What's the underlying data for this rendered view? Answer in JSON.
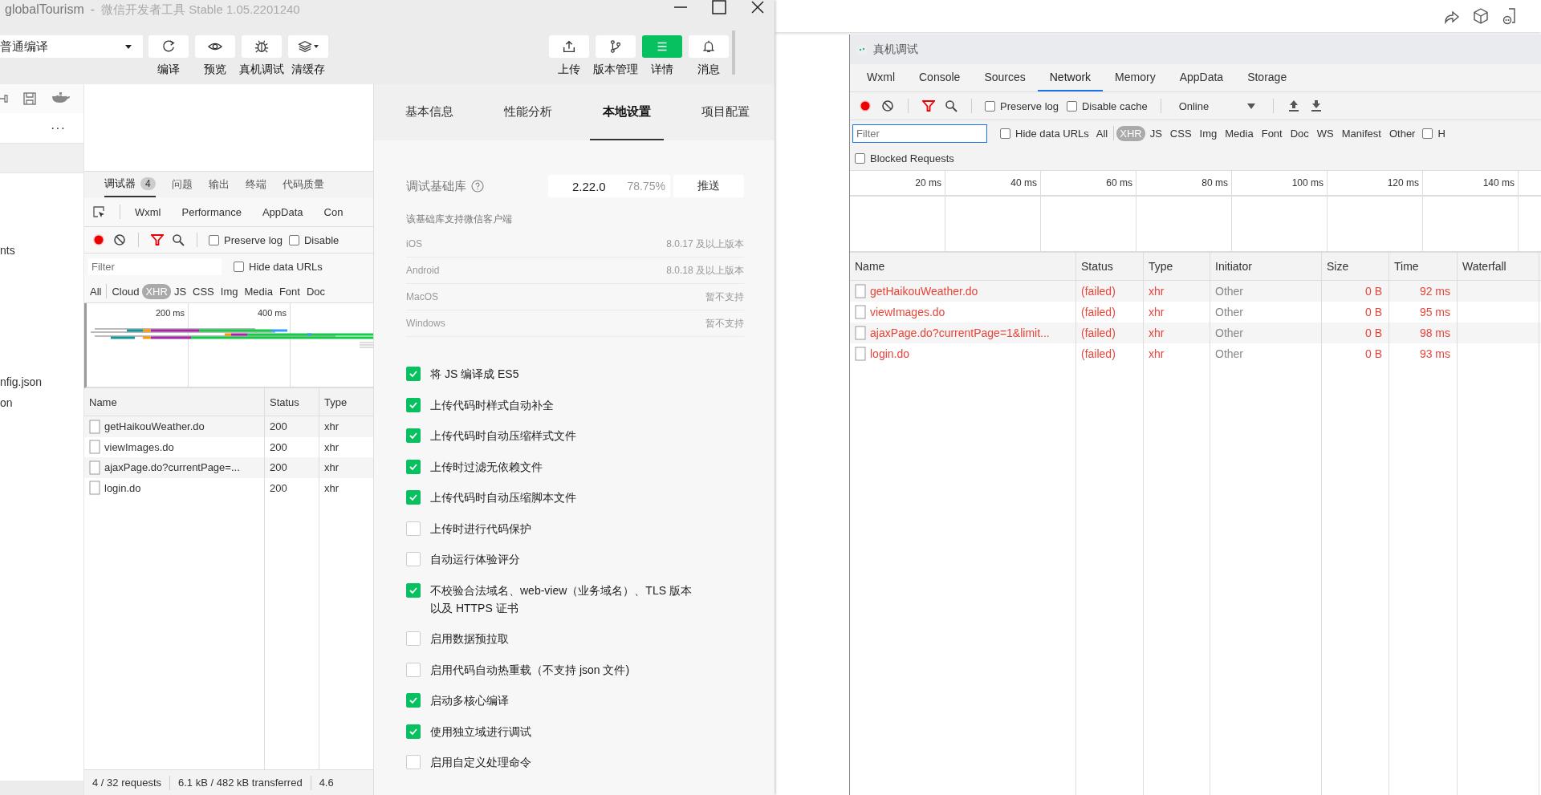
{
  "ide_window": {
    "project": "globalTourism",
    "separator": "-",
    "app": "微信开发者工具 Stable 1.05.2201240",
    "compile_mode": "普通编译",
    "toolbar_left": [
      {
        "label": "编译",
        "kind": "compile"
      },
      {
        "label": "预览",
        "kind": "preview"
      },
      {
        "label": "真机调试",
        "kind": "debug"
      },
      {
        "label": "清缓存",
        "kind": "cache"
      }
    ],
    "toolbar_right": [
      {
        "label": "上传",
        "kind": "upload",
        "selected": false
      },
      {
        "label": "版本管理",
        "kind": "branch",
        "selected": false
      },
      {
        "label": "详情",
        "kind": "details",
        "selected": true
      },
      {
        "label": "消息",
        "kind": "bell",
        "selected": false
      }
    ],
    "sidebar": {
      "more": "···",
      "items": [
        "nts",
        "nfig.json",
        "on"
      ]
    },
    "debugger": {
      "tabs": [
        {
          "label": "调试器",
          "badge": "4",
          "selected": true
        },
        {
          "label": "问题",
          "selected": false
        },
        {
          "label": "输出",
          "selected": false
        },
        {
          "label": "终端",
          "selected": false
        },
        {
          "label": "代码质量",
          "selected": false
        }
      ],
      "panels": [
        {
          "label": "Wxml",
          "selected": false
        },
        {
          "label": "Performance",
          "selected": false
        },
        {
          "label": "AppData",
          "selected": false
        },
        {
          "label": "Con",
          "selected": false
        }
      ],
      "preserve_log": {
        "label": "Preserve log",
        "checked": false
      },
      "disable_cache": {
        "label": "Disable",
        "checked": false
      },
      "filter": {
        "placeholder": "Filter"
      },
      "hide_data_urls": {
        "label": "Hide data URLs",
        "checked": false
      },
      "types": [
        {
          "label": "All",
          "selected": false
        },
        {
          "label": "Cloud",
          "selected": false
        },
        {
          "label": "XHR",
          "selected": true
        },
        {
          "label": "JS",
          "selected": false
        },
        {
          "label": "CSS",
          "selected": false
        },
        {
          "label": "Img",
          "selected": false
        },
        {
          "label": "Media",
          "selected": false
        },
        {
          "label": "Font",
          "selected": false
        },
        {
          "label": "Doc",
          "selected": false
        }
      ],
      "ticks": [
        "200 ms",
        "400 ms"
      ],
      "table": {
        "columns": [
          "Name",
          "Status",
          "Type"
        ],
        "rows": [
          {
            "name": "getHaikouWeather.do",
            "status": "200",
            "type": "xhr"
          },
          {
            "name": "viewImages.do",
            "status": "200",
            "type": "xhr"
          },
          {
            "name": "ajaxPage.do?currentPage=...",
            "status": "200",
            "type": "xhr"
          },
          {
            "name": "login.do",
            "status": "200",
            "type": "xhr"
          }
        ]
      },
      "status_bar": [
        "4 / 32 requests",
        "6.1 kB / 482 kB transferred",
        "4.6"
      ]
    },
    "details": {
      "tabs": [
        {
          "label": "基本信息",
          "selected": false
        },
        {
          "label": "性能分析",
          "selected": false
        },
        {
          "label": "本地设置",
          "selected": true
        },
        {
          "label": "项目配置",
          "selected": false
        }
      ],
      "library": {
        "label": "调试基础库",
        "version": "2.22.0",
        "share": "78.75%",
        "button": "推送"
      },
      "support_title": "该基础库支持微信客户端",
      "support": [
        {
          "platform": "iOS",
          "value": "8.0.17 及以上版本"
        },
        {
          "platform": "Android",
          "value": "8.0.18 及以上版本"
        },
        {
          "platform": "MacOS",
          "value": "暂不支持"
        },
        {
          "platform": "Windows",
          "value": "暂不支持"
        }
      ],
      "options": [
        {
          "label": "将 JS 编译成 ES5",
          "checked": true
        },
        {
          "label": "上传代码时样式自动补全",
          "checked": true
        },
        {
          "label": "上传代码时自动压缩样式文件",
          "checked": true
        },
        {
          "label": "上传时过滤无依赖文件",
          "checked": true
        },
        {
          "label": "上传代码时自动压缩脚本文件",
          "checked": true
        },
        {
          "label": "上传时进行代码保护",
          "checked": false
        },
        {
          "label": "自动运行体验评分",
          "checked": false
        },
        {
          "label": "不校验合法域名、web-view（业务域名）、TLS 版本以及 HTTPS 证书",
          "checked": true
        },
        {
          "label": "启用数据预拉取",
          "checked": false
        },
        {
          "label": "启用代码自动热重载（不支持 json 文件)",
          "checked": false
        },
        {
          "label": "启动多核心编译",
          "checked": true
        },
        {
          "label": "使用独立域进行调试",
          "checked": true
        },
        {
          "label": "启用自定义处理命令",
          "checked": false
        }
      ]
    }
  },
  "remote_window": {
    "title": "真机调试",
    "tabs": [
      {
        "label": "Wxml",
        "selected": false
      },
      {
        "label": "Console",
        "selected": false
      },
      {
        "label": "Sources",
        "selected": false
      },
      {
        "label": "Network",
        "selected": true
      },
      {
        "label": "Memory",
        "selected": false
      },
      {
        "label": "AppData",
        "selected": false
      },
      {
        "label": "Storage",
        "selected": false
      }
    ],
    "preserve_log": {
      "label": "Preserve log",
      "checked": false
    },
    "disable_cache": {
      "label": "Disable cache",
      "checked": false
    },
    "throttling": "Online",
    "filter": {
      "placeholder": "Filter"
    },
    "hide_data_urls": {
      "label": "Hide data URLs",
      "checked": false
    },
    "types": [
      {
        "label": "All",
        "selected": false
      },
      {
        "label": "XHR",
        "selected": true
      },
      {
        "label": "JS",
        "selected": false
      },
      {
        "label": "CSS",
        "selected": false
      },
      {
        "label": "Img",
        "selected": false
      },
      {
        "label": "Media",
        "selected": false
      },
      {
        "label": "Font",
        "selected": false
      },
      {
        "label": "Doc",
        "selected": false
      },
      {
        "label": "WS",
        "selected": false
      },
      {
        "label": "Manifest",
        "selected": false
      },
      {
        "label": "Other",
        "selected": false
      }
    ],
    "cut_option": {
      "label": "H",
      "checked": false
    },
    "blocked_requests": {
      "label": "Blocked Requests",
      "checked": false
    },
    "ticks": [
      "20 ms",
      "40 ms",
      "60 ms",
      "80 ms",
      "100 ms",
      "120 ms",
      "140 ms"
    ],
    "table": {
      "columns": [
        "Name",
        "Status",
        "Type",
        "Initiator",
        "Size",
        "Time",
        "Waterfall"
      ],
      "rows": [
        {
          "name": "getHaikouWeather.do",
          "status": "(failed)",
          "type": "xhr",
          "initiator": "Other",
          "size": "0 B",
          "time": "92 ms"
        },
        {
          "name": "viewImages.do",
          "status": "(failed)",
          "type": "xhr",
          "initiator": "Other",
          "size": "0 B",
          "time": "95 ms"
        },
        {
          "name": "ajaxPage.do?currentPage=1&limit...",
          "status": "(failed)",
          "type": "xhr",
          "initiator": "Other",
          "size": "0 B",
          "time": "98 ms"
        },
        {
          "name": "login.do",
          "status": "(failed)",
          "type": "xhr",
          "initiator": "Other",
          "size": "0 B",
          "time": "93 ms"
        }
      ]
    }
  }
}
